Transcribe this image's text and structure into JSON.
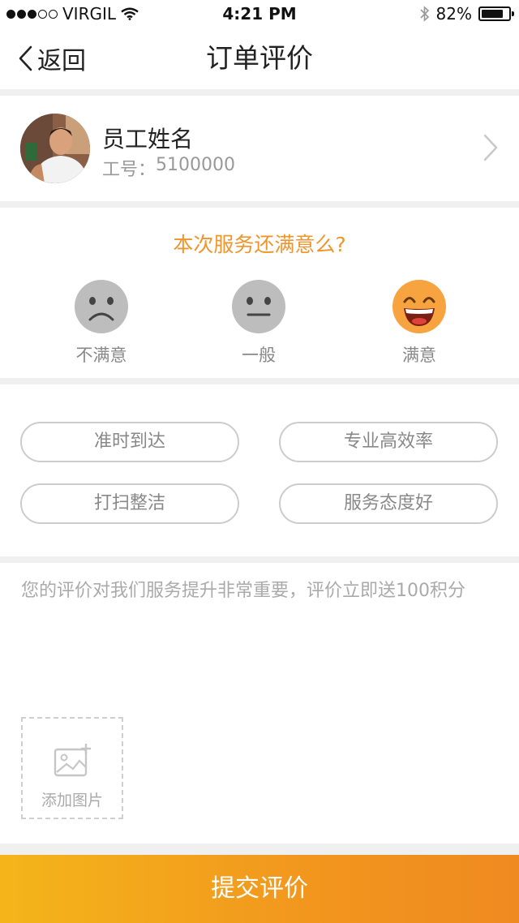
{
  "status_bar": {
    "carrier": "VIRGIL",
    "time": "4:21 PM",
    "battery": "82%",
    "battery_level": 0.82
  },
  "nav": {
    "back_label": "返回",
    "title": "订单评价"
  },
  "staff": {
    "name": "员工姓名",
    "id_label": "工号：",
    "id_value": "5100000"
  },
  "rating": {
    "question": "本次服务还满意么?",
    "options": [
      {
        "label": "不满意",
        "selected": false
      },
      {
        "label": "一般",
        "selected": false
      },
      {
        "label": "满意",
        "selected": true
      }
    ]
  },
  "tags": [
    "准时到达",
    "专业高效率",
    "打扫整洁",
    "服务态度好"
  ],
  "comment": {
    "placeholder": "您的评价对我们服务提升非常重要，评价立即送100积分"
  },
  "add_image": {
    "label": "添加图片"
  },
  "submit": {
    "label": "提交评价"
  },
  "colors": {
    "accent": "#f0952c",
    "button_start": "#f4b51a",
    "button_end": "#ef8a20",
    "face_gray": "#bdbdbd",
    "face_happy": "#f7a440"
  }
}
